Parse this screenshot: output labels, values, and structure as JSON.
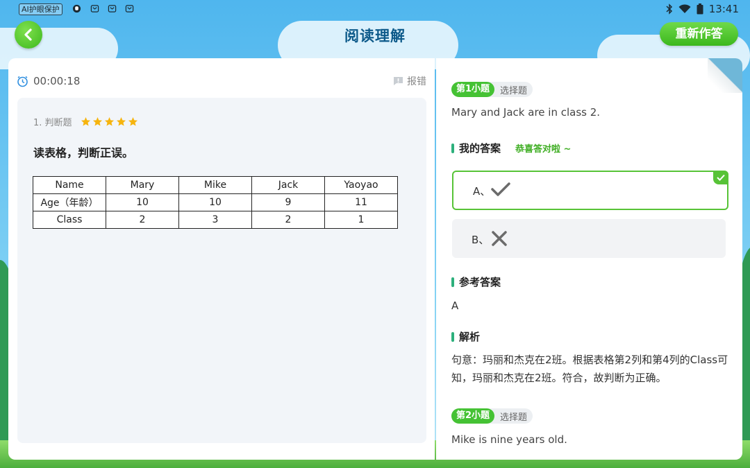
{
  "status_bar": {
    "eye_protect_label": "AI护眼保护",
    "time": "13:41"
  },
  "header": {
    "title": "阅读理解",
    "redo_label": "重新作答"
  },
  "left": {
    "timer": "00:00:18",
    "report_label": "报错",
    "question": {
      "head": "1. 判断题",
      "stars": 5,
      "text": "读表格，判断正误。",
      "table": {
        "header": [
          "Name",
          "Mary",
          "Mike",
          "Jack",
          "Yaoyao"
        ],
        "rows": [
          [
            "Age（年龄）",
            "10",
            "10",
            "9",
            "11"
          ],
          [
            "Class",
            "2",
            "3",
            "2",
            "1"
          ]
        ]
      }
    }
  },
  "right": {
    "q1": {
      "num_label": "第1小题",
      "type_label": "选择题",
      "stem": "Mary and Jack are in class 2.",
      "my_answer_title": "我的答案",
      "congrats": "恭喜答对啦 ~",
      "options": [
        {
          "label": "A、",
          "icon": "check-icon",
          "selected": true
        },
        {
          "label": "B、",
          "icon": "cross-icon",
          "selected": false
        }
      ],
      "ref_title": "参考答案",
      "ref_answer": "A",
      "analysis_title": "解析",
      "analysis_text": "句意：玛丽和杰克在2班。根据表格第2列和第4列的Class可知，玛丽和杰克在2班。符合，故判断为正确。"
    },
    "q2": {
      "num_label": "第2小题",
      "type_label": "选择题",
      "stem": "Mike is nine years old."
    }
  },
  "colors": {
    "accent_green": "#45c234",
    "title_blue": "#0d5a8a",
    "section_bar": "#2db07c"
  }
}
